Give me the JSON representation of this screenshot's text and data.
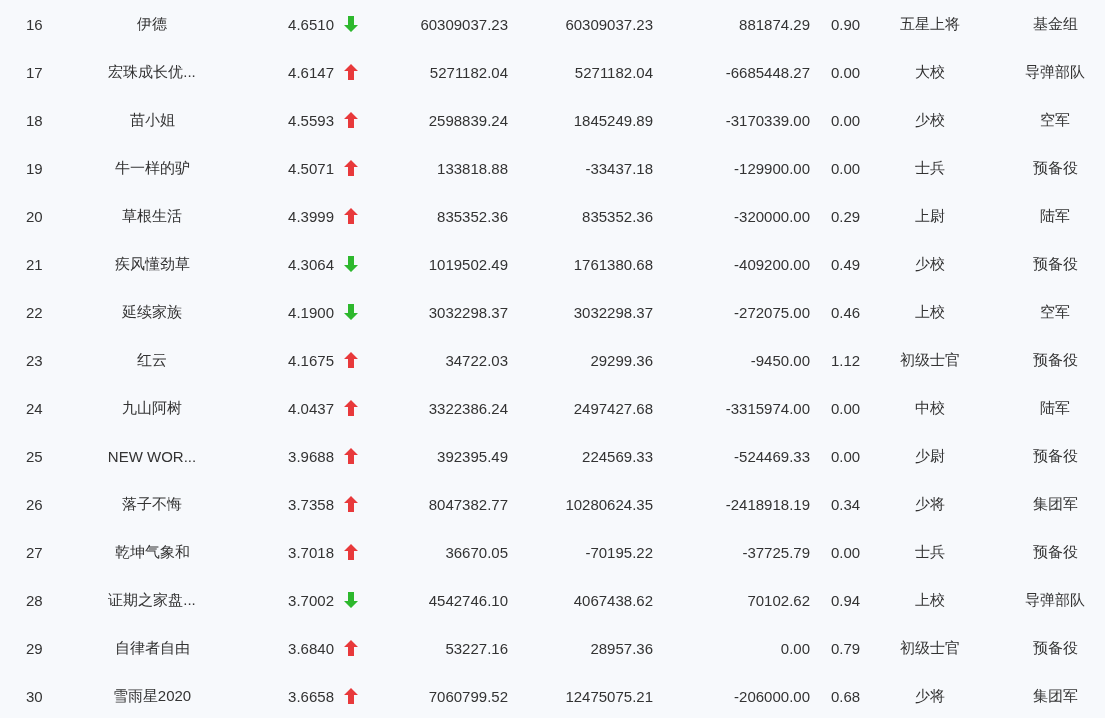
{
  "table": {
    "rows": [
      {
        "rank": "16",
        "name": "伊德",
        "score": "4.6510",
        "kind": "down",
        "column_4": "60309037.23",
        "column_5": "60309037.23",
        "column_6": "881874.29",
        "column_7": "0.90",
        "level": "五星上将",
        "group": "基金组"
      },
      {
        "rank": "17",
        "name": "宏珠成长优...",
        "score": "4.6147",
        "kind": "up",
        "column_4": "5271182.04",
        "column_5": "5271182.04",
        "column_6": "-6685448.27",
        "column_7": "0.00",
        "level": "大校",
        "group": "导弹部队"
      },
      {
        "rank": "18",
        "name": "苗小姐",
        "score": "4.5593",
        "kind": "up",
        "column_4": "2598839.24",
        "column_5": "1845249.89",
        "column_6": "-3170339.00",
        "column_7": "0.00",
        "level": "少校",
        "group": "空军"
      },
      {
        "rank": "19",
        "name": "牛一样的驴",
        "score": "4.5071",
        "kind": "up",
        "column_4": "133818.88",
        "column_5": "-33437.18",
        "column_6": "-129900.00",
        "column_7": "0.00",
        "level": "士兵",
        "group": "预备役"
      },
      {
        "rank": "20",
        "name": "草根生活",
        "score": "4.3999",
        "kind": "up",
        "column_4": "835352.36",
        "column_5": "835352.36",
        "column_6": "-320000.00",
        "column_7": "0.29",
        "level": "上尉",
        "group": "陆军"
      },
      {
        "rank": "21",
        "name": "疾风懂劲草",
        "score": "4.3064",
        "kind": "down",
        "column_4": "1019502.49",
        "column_5": "1761380.68",
        "column_6": "-409200.00",
        "column_7": "0.49",
        "level": "少校",
        "group": "预备役"
      },
      {
        "rank": "22",
        "name": "延续家族",
        "score": "4.1900",
        "kind": "down",
        "column_4": "3032298.37",
        "column_5": "3032298.37",
        "column_6": "-272075.00",
        "column_7": "0.46",
        "level": "上校",
        "group": "空军"
      },
      {
        "rank": "23",
        "name": "红云",
        "score": "4.1675",
        "kind": "up",
        "column_4": "34722.03",
        "column_5": "29299.36",
        "column_6": "-9450.00",
        "column_7": "1.12",
        "level": "初级士官",
        "group": "预备役"
      },
      {
        "rank": "24",
        "name": "九山阿树",
        "score": "4.0437",
        "kind": "up",
        "column_4": "3322386.24",
        "column_5": "2497427.68",
        "column_6": "-3315974.00",
        "column_7": "0.00",
        "level": "中校",
        "group": "陆军"
      },
      {
        "rank": "25",
        "name": "NEW WOR...",
        "score": "3.9688",
        "kind": "up",
        "column_4": "392395.49",
        "column_5": "224569.33",
        "column_6": "-524469.33",
        "column_7": "0.00",
        "level": "少尉",
        "group": "预备役"
      },
      {
        "rank": "26",
        "name": "落子不悔",
        "score": "3.7358",
        "kind": "up",
        "column_4": "8047382.77",
        "column_5": "10280624.35",
        "column_6": "-2418918.19",
        "column_7": "0.34",
        "level": "少将",
        "group": "集团军"
      },
      {
        "rank": "27",
        "name": "乾坤气象和",
        "score": "3.7018",
        "kind": "up",
        "column_4": "36670.05",
        "column_5": "-70195.22",
        "column_6": "-37725.79",
        "column_7": "0.00",
        "level": "士兵",
        "group": "预备役"
      },
      {
        "rank": "28",
        "name": "证期之家盘...",
        "score": "3.7002",
        "kind": "down",
        "column_4": "4542746.10",
        "column_5": "4067438.62",
        "column_6": "70102.62",
        "column_7": "0.94",
        "level": "上校",
        "group": "导弹部队"
      },
      {
        "rank": "29",
        "name": "自律者自由",
        "score": "3.6840",
        "kind": "up",
        "column_4": "53227.16",
        "column_5": "28957.36",
        "column_6": "0.00",
        "column_7": "0.79",
        "level": "初级士官",
        "group": "预备役"
      },
      {
        "rank": "30",
        "name": "雪雨星2020",
        "score": "3.6658",
        "kind": "up",
        "column_4": "7060799.52",
        "column_5": "12475075.21",
        "column_6": "-206000.00",
        "column_7": "0.68",
        "level": "少将",
        "group": "集团军"
      }
    ]
  }
}
